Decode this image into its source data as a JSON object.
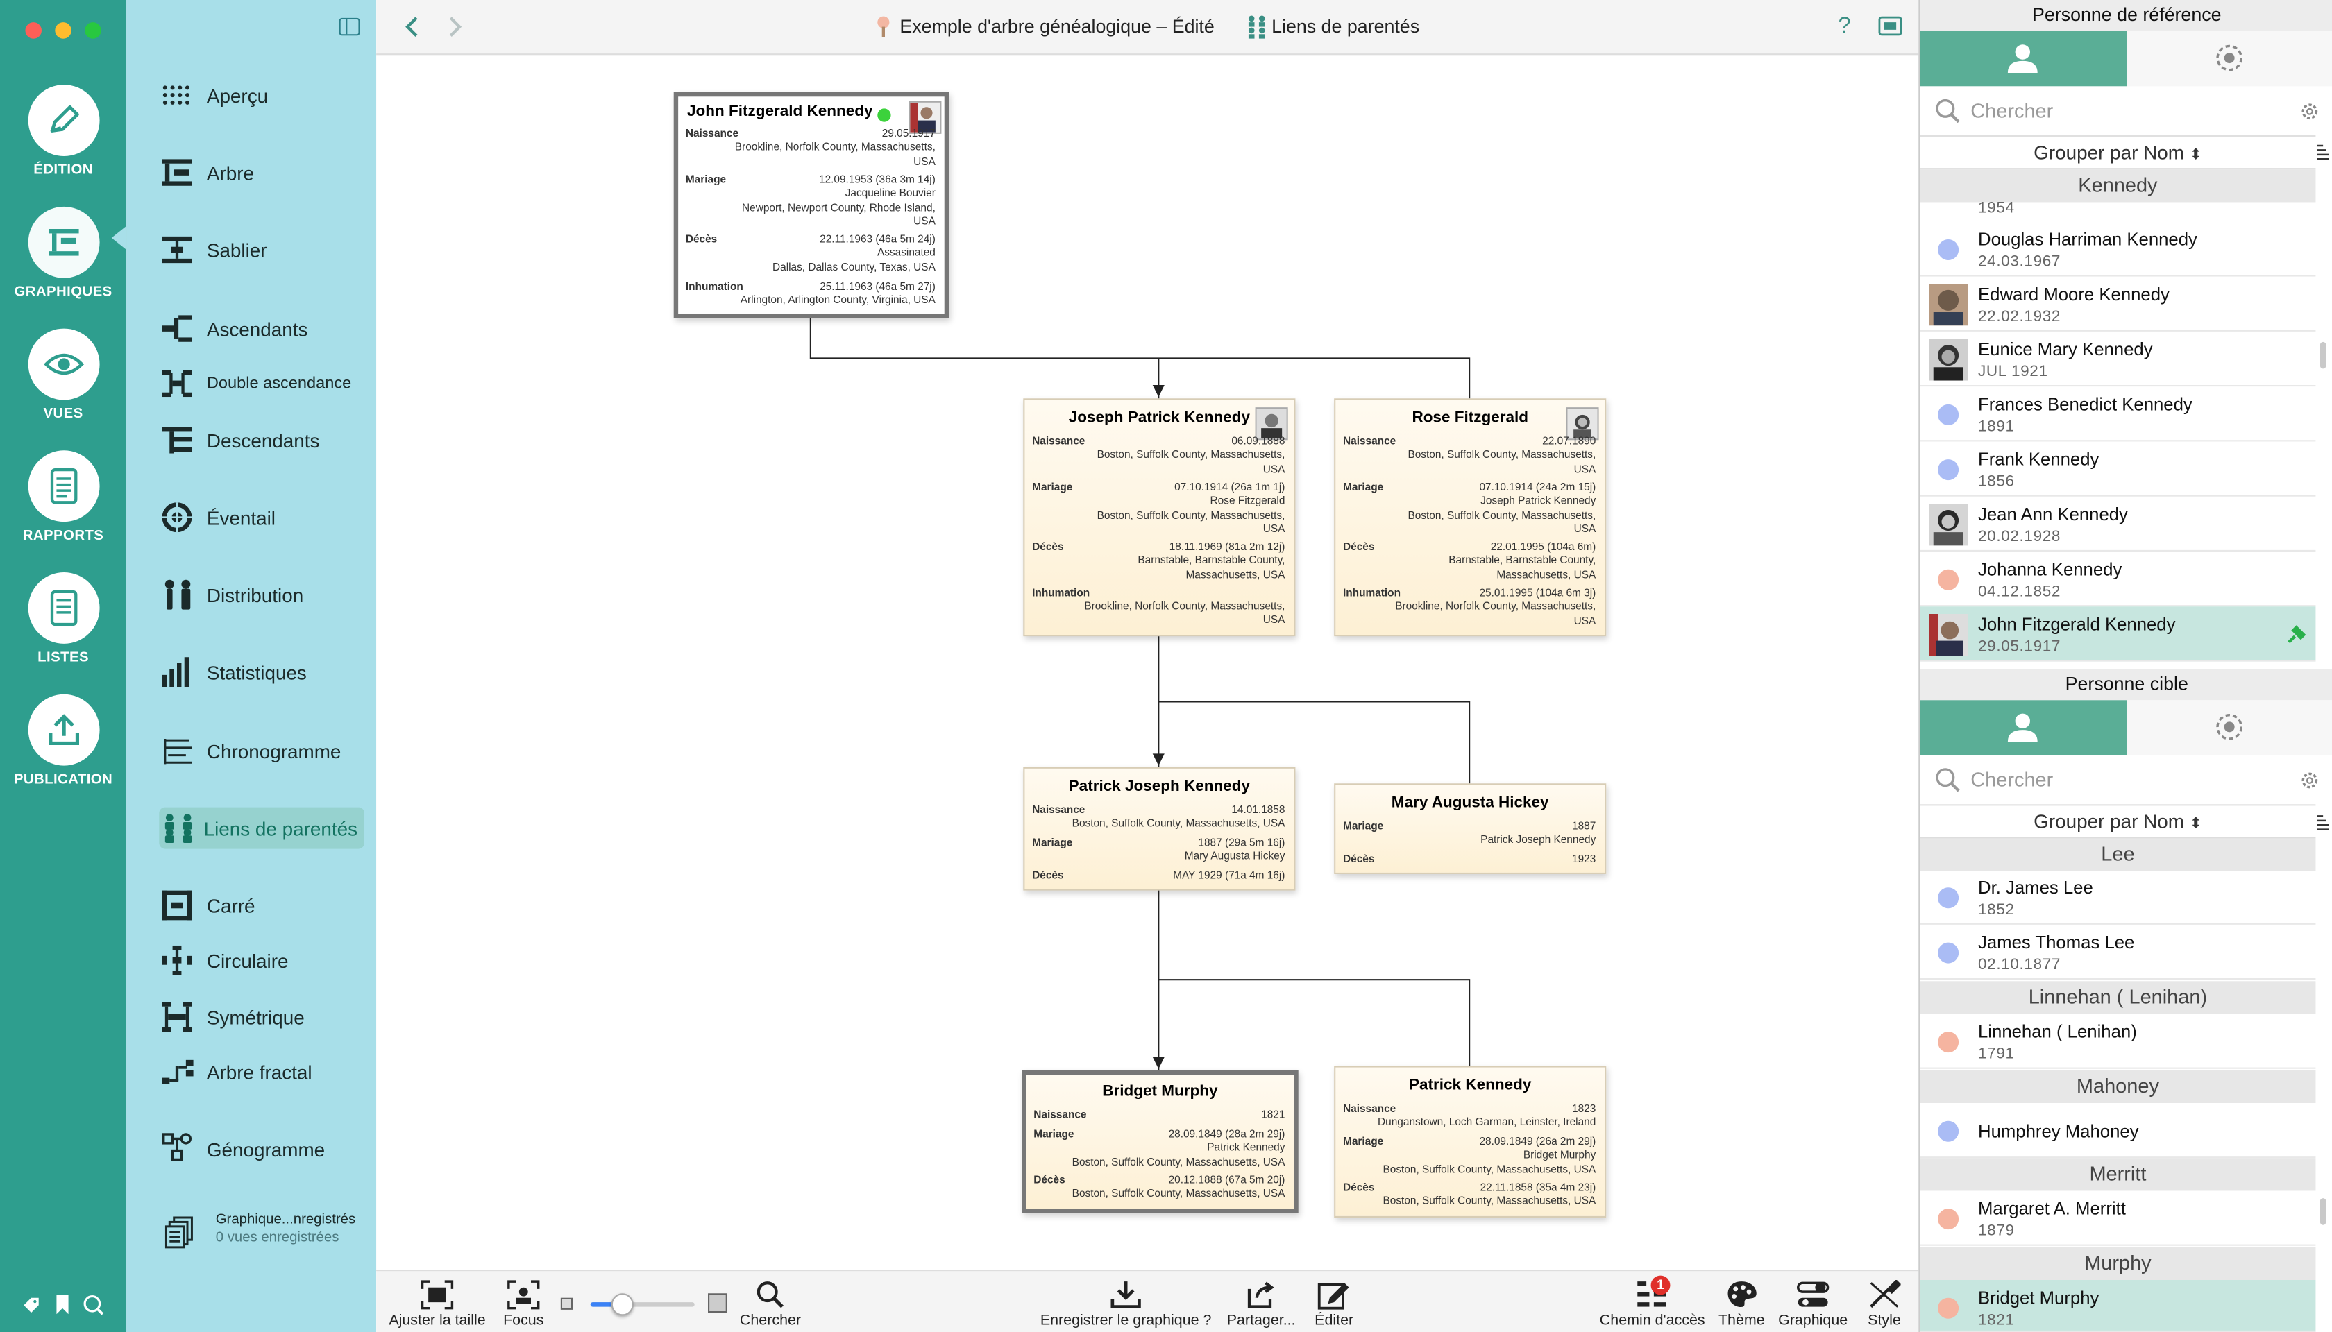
{
  "window": {
    "title": "Exemple d'arbre généalogique – Édité",
    "mode_label": "Liens de parentés"
  },
  "colors": {
    "rail": "#2e9e8e",
    "sidebar": "#a8dfe9",
    "accent": "#5aae96",
    "selected_row": "#c7e6df",
    "dot_male": "#aabcf5",
    "dot_female": "#f5b4a0",
    "online": "#3cd23c"
  },
  "rail": [
    {
      "label": "ÉDITION",
      "icon": "pencil-icon"
    },
    {
      "label": "GRAPHIQUES",
      "icon": "chart-icon"
    },
    {
      "label": "VUES",
      "icon": "eye-icon"
    },
    {
      "label": "RAPPORTS",
      "icon": "report-icon"
    },
    {
      "label": "LISTES",
      "icon": "list-icon"
    },
    {
      "label": "PUBLICATION",
      "icon": "upload-icon"
    }
  ],
  "sidebar": {
    "items": [
      {
        "label": "Aperçu",
        "icon": "grid-dots-icon"
      },
      {
        "label": "Arbre",
        "icon": "tree-icon"
      },
      {
        "label": "Sablier",
        "icon": "hourglass-icon"
      },
      {
        "label": "Ascendants",
        "icon": "ancestors-icon"
      },
      {
        "label": "Double ascendance",
        "icon": "double-ancestry-icon"
      },
      {
        "label": "Descendants",
        "icon": "descendants-icon"
      },
      {
        "label": "Éventail",
        "icon": "fan-icon"
      },
      {
        "label": "Distribution",
        "icon": "distribution-icon"
      },
      {
        "label": "Statistiques",
        "icon": "statistics-icon"
      },
      {
        "label": "Chronogramme",
        "icon": "timeline-icon"
      },
      {
        "label": "Liens de parentés",
        "icon": "relationship-icon"
      },
      {
        "label": "Carré",
        "icon": "square-icon"
      },
      {
        "label": "Circulaire",
        "icon": "circular-icon"
      },
      {
        "label": "Symétrique",
        "icon": "symmetric-icon"
      },
      {
        "label": "Arbre fractal",
        "icon": "fractal-icon"
      },
      {
        "label": "Génogramme",
        "icon": "genogram-icon"
      }
    ],
    "saved": {
      "label": "Graphique...nregistrés",
      "sub": "0 vues enregistrées"
    }
  },
  "chart": {
    "cards": [
      {
        "name": "John Fitzgerald Kennedy",
        "events": [
          {
            "label": "Naissance",
            "lines": [
              "29.05.1917",
              "Brookline, Norfolk County, Massachusetts,",
              "USA"
            ]
          },
          {
            "label": "Mariage",
            "lines": [
              "12.09.1953 (36a 3m 14j)",
              "Jacqueline Bouvier",
              "Newport, Newport County, Rhode Island,",
              "USA"
            ]
          },
          {
            "label": "Décès",
            "lines": [
              "22.11.1963 (46a 5m 24j)",
              "Assasinated",
              "Dallas, Dallas County, Texas, USA"
            ]
          },
          {
            "label": "Inhumation",
            "lines": [
              "25.11.1963 (46a 5m 27j)",
              "Arlington, Arlington County, Virginia, USA"
            ]
          }
        ]
      },
      {
        "name": "Joseph Patrick Kennedy",
        "events": [
          {
            "label": "Naissance",
            "lines": [
              "06.09.1888",
              "Boston, Suffolk County, Massachusetts,",
              "USA"
            ]
          },
          {
            "label": "Mariage",
            "lines": [
              "07.10.1914 (26a 1m 1j)",
              "Rose Fitzgerald",
              "Boston, Suffolk County, Massachusetts,",
              "USA"
            ]
          },
          {
            "label": "Décès",
            "lines": [
              "18.11.1969 (81a 2m 12j)",
              "Barnstable, Barnstable County,",
              "Massachusetts, USA"
            ]
          },
          {
            "label": "Inhumation",
            "lines": [
              "Brookline, Norfolk County, Massachusetts,",
              "USA"
            ]
          }
        ]
      },
      {
        "name": "Rose Fitzgerald",
        "events": [
          {
            "label": "Naissance",
            "lines": [
              "22.07.1890",
              "Boston, Suffolk County, Massachusetts,",
              "USA"
            ]
          },
          {
            "label": "Mariage",
            "lines": [
              "07.10.1914 (24a 2m 15j)",
              "Joseph Patrick Kennedy",
              "Boston, Suffolk County, Massachusetts,",
              "USA"
            ]
          },
          {
            "label": "Décès",
            "lines": [
              "22.01.1995 (104a 6m)",
              "Barnstable, Barnstable County,",
              "Massachusetts, USA"
            ]
          },
          {
            "label": "Inhumation",
            "lines": [
              "25.01.1995 (104a 6m 3j)",
              "Brookline, Norfolk County, Massachusetts,",
              "USA"
            ]
          }
        ]
      },
      {
        "name": "Patrick Joseph Kennedy",
        "events": [
          {
            "label": "Naissance",
            "lines": [
              "14.01.1858",
              "Boston, Suffolk County, Massachusetts, USA"
            ]
          },
          {
            "label": "Mariage",
            "lines": [
              "1887 (29a 5m 16j)",
              "Mary Augusta Hickey"
            ]
          },
          {
            "label": "Décès",
            "lines": [
              "MAY 1929 (71a 4m 16j)"
            ]
          }
        ]
      },
      {
        "name": "Mary Augusta Hickey",
        "events": [
          {
            "label": "Mariage",
            "lines": [
              "1887",
              "Patrick Joseph Kennedy"
            ]
          },
          {
            "label": "Décès",
            "lines": [
              "1923"
            ]
          }
        ]
      },
      {
        "name": "Bridget Murphy",
        "events": [
          {
            "label": "Naissance",
            "lines": [
              "1821"
            ]
          },
          {
            "label": "Mariage",
            "lines": [
              "28.09.1849 (28a 2m 29j)",
              "Patrick Kennedy",
              "Boston, Suffolk County, Massachusetts, USA"
            ]
          },
          {
            "label": "Décès",
            "lines": [
              "20.12.1888 (67a 5m 20j)",
              "Boston, Suffolk County, Massachusetts, USA"
            ]
          }
        ]
      },
      {
        "name": "Patrick Kennedy",
        "events": [
          {
            "label": "Naissance",
            "lines": [
              "1823",
              "Dunganstown, Loch Garman, Leinster, Ireland"
            ]
          },
          {
            "label": "Mariage",
            "lines": [
              "28.09.1849 (26a 2m 29j)",
              "Bridget Murphy",
              "Boston, Suffolk County, Massachusetts, USA"
            ]
          },
          {
            "label": "Décès",
            "lines": [
              "22.11.1858 (35a 4m 23j)",
              "Boston, Suffolk County, Massachusetts, USA"
            ]
          }
        ]
      }
    ]
  },
  "toolbar_bottom": {
    "fit": "Ajuster la taille",
    "focus": "Focus",
    "search": "Chercher",
    "save": "Enregistrer le graphique ?",
    "share": "Partager...",
    "edit": "Éditer",
    "path": "Chemin d'accès",
    "path_badge": "1",
    "theme": "Thème",
    "graph": "Graphique",
    "style": "Style",
    "zoom_level": 0.3
  },
  "right": {
    "ref": {
      "title": "Personne de référence",
      "search_placeholder": "Chercher",
      "group": "Grouper par Nom",
      "top_partial": "1954",
      "sections": [
        {
          "title": "Kennedy",
          "rows": [
            {
              "name": "Douglas Harriman Kennedy",
              "date": "24.03.1967",
              "avatar": "dot-male"
            },
            {
              "name": "Edward Moore Kennedy",
              "date": "22.02.1932",
              "avatar": "photo"
            },
            {
              "name": "Eunice Mary Kennedy",
              "date": "JUL 1921",
              "avatar": "photo"
            },
            {
              "name": "Frances Benedict Kennedy",
              "date": "1891",
              "avatar": "dot-male"
            },
            {
              "name": "Frank Kennedy",
              "date": "1856",
              "avatar": "dot-male"
            },
            {
              "name": "Jean Ann Kennedy",
              "date": "20.02.1928",
              "avatar": "photo"
            },
            {
              "name": "Johanna Kennedy",
              "date": "04.12.1852",
              "avatar": "dot-female"
            },
            {
              "name": "John Fitzgerald Kennedy",
              "date": "29.05.1917",
              "avatar": "photo",
              "selected": true
            }
          ]
        }
      ]
    },
    "target": {
      "title": "Personne cible",
      "search_placeholder": "Chercher",
      "group": "Grouper par Nom",
      "sections": [
        {
          "title": "Lee",
          "rows": [
            {
              "name": "Dr. James Lee",
              "date": "1852",
              "avatar": "dot-male"
            },
            {
              "name": "James Thomas Lee",
              "date": "02.10.1877",
              "avatar": "dot-male"
            }
          ]
        },
        {
          "title": "Linnehan ( Lenihan)",
          "rows": [
            {
              "name": "Linnehan ( Lenihan)",
              "date": "1791",
              "avatar": "dot-female"
            }
          ]
        },
        {
          "title": "Mahoney",
          "rows": [
            {
              "name": "Humphrey Mahoney",
              "date": "",
              "avatar": "dot-male"
            }
          ]
        },
        {
          "title": "Merritt",
          "rows": [
            {
              "name": "Margaret A. Merritt",
              "date": "1879",
              "avatar": "dot-female"
            }
          ]
        },
        {
          "title": "Murphy",
          "rows": [
            {
              "name": "Bridget Murphy",
              "date": "1821",
              "avatar": "dot-female",
              "selected": true
            }
          ]
        }
      ]
    }
  }
}
